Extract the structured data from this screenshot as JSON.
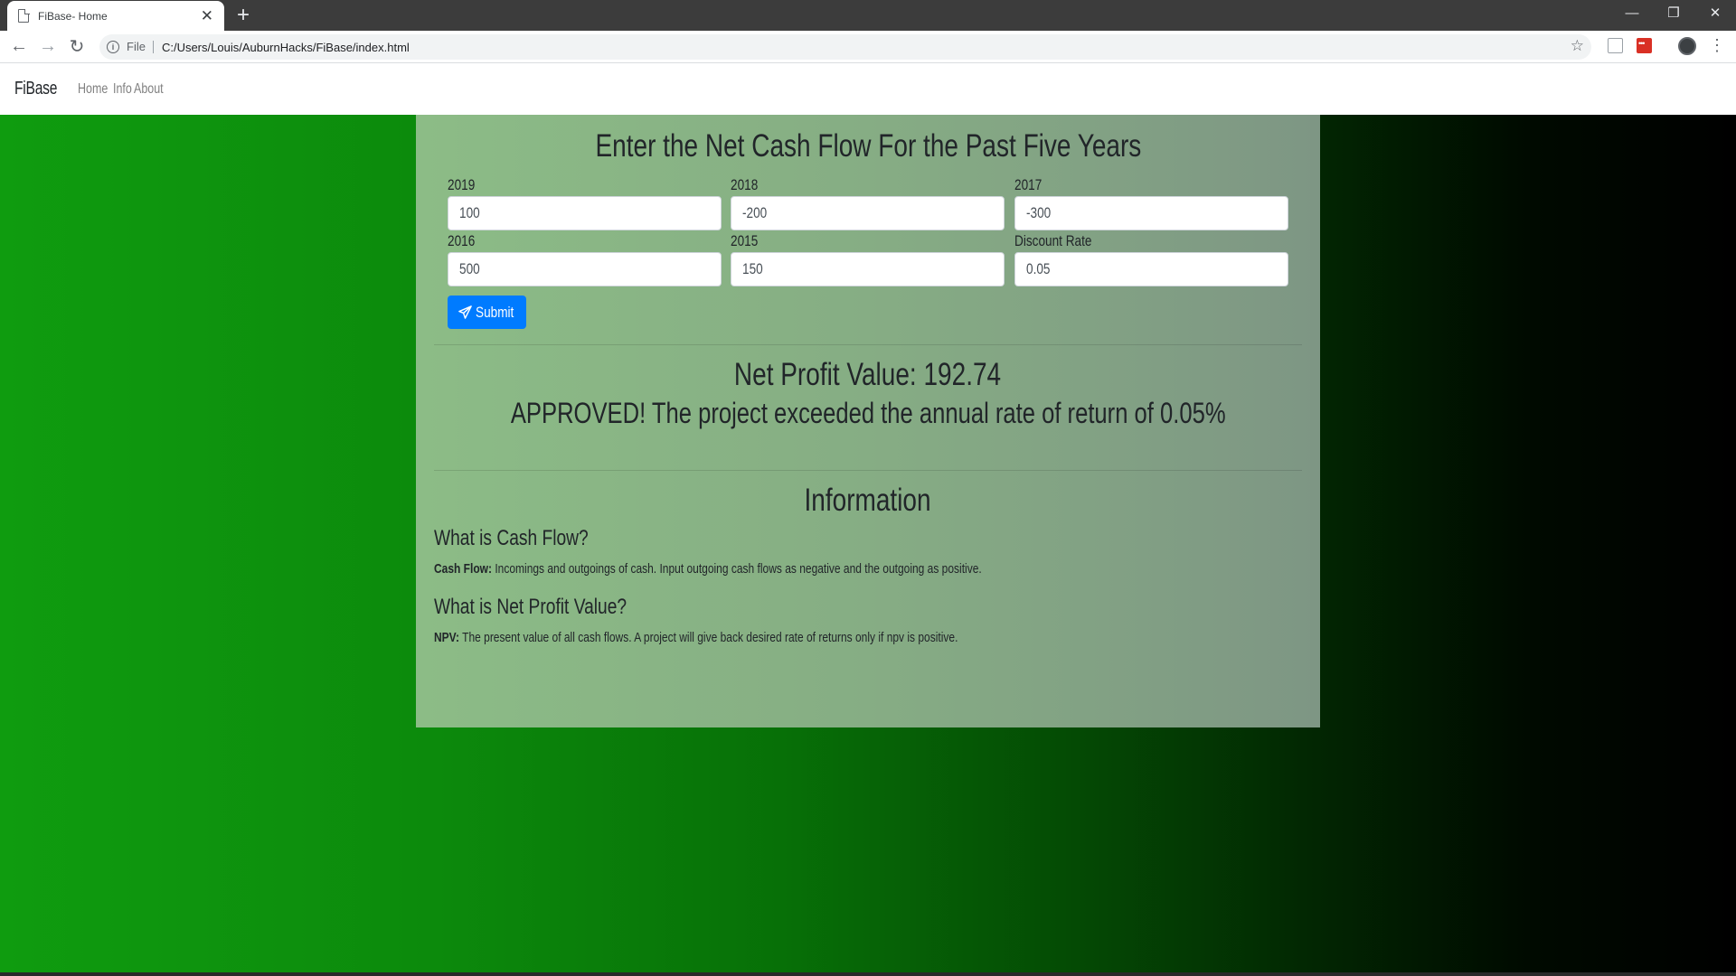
{
  "browser": {
    "tab_title": "FiBase- Home",
    "new_tab": "+",
    "file_label": "File",
    "url": "C:/Users/Louis/AuburnHacks/FiBase/index.html"
  },
  "navbar": {
    "brand": "FiBase",
    "links": [
      "Home",
      "Info",
      "About"
    ]
  },
  "form": {
    "title": "Enter the Net Cash Flow For the Past Five Years",
    "fields": [
      {
        "label": "2019",
        "value": "100"
      },
      {
        "label": "2018",
        "value": "-200"
      },
      {
        "label": "2017",
        "value": "-300"
      },
      {
        "label": "2016",
        "value": "500"
      },
      {
        "label": "2015",
        "value": "150"
      },
      {
        "label": "Discount Rate",
        "value": "0.05"
      }
    ],
    "submit_label": "Submit"
  },
  "result": {
    "npv_line": "Net Profit Value: 192.74",
    "verdict": "APPROVED! The project exceeded the annual rate of return of 0.05%"
  },
  "information": {
    "heading": "Information",
    "q1": "What is Cash Flow?",
    "a1_term": "Cash Flow:",
    "a1_text": " Incomings and outgoings of cash. Input outgoing cash flows as negative and the outgoing as positive.",
    "q2": "What is Net Profit Value?",
    "a2_term": "NPV:",
    "a2_text": " The present value of all cash flows. A project will give back desired rate of returns only if npv is positive."
  },
  "colors": {
    "accent": "#007bff",
    "panel": "#86ad84",
    "background_left": "#0f9c0f",
    "background_right": "#000000"
  }
}
